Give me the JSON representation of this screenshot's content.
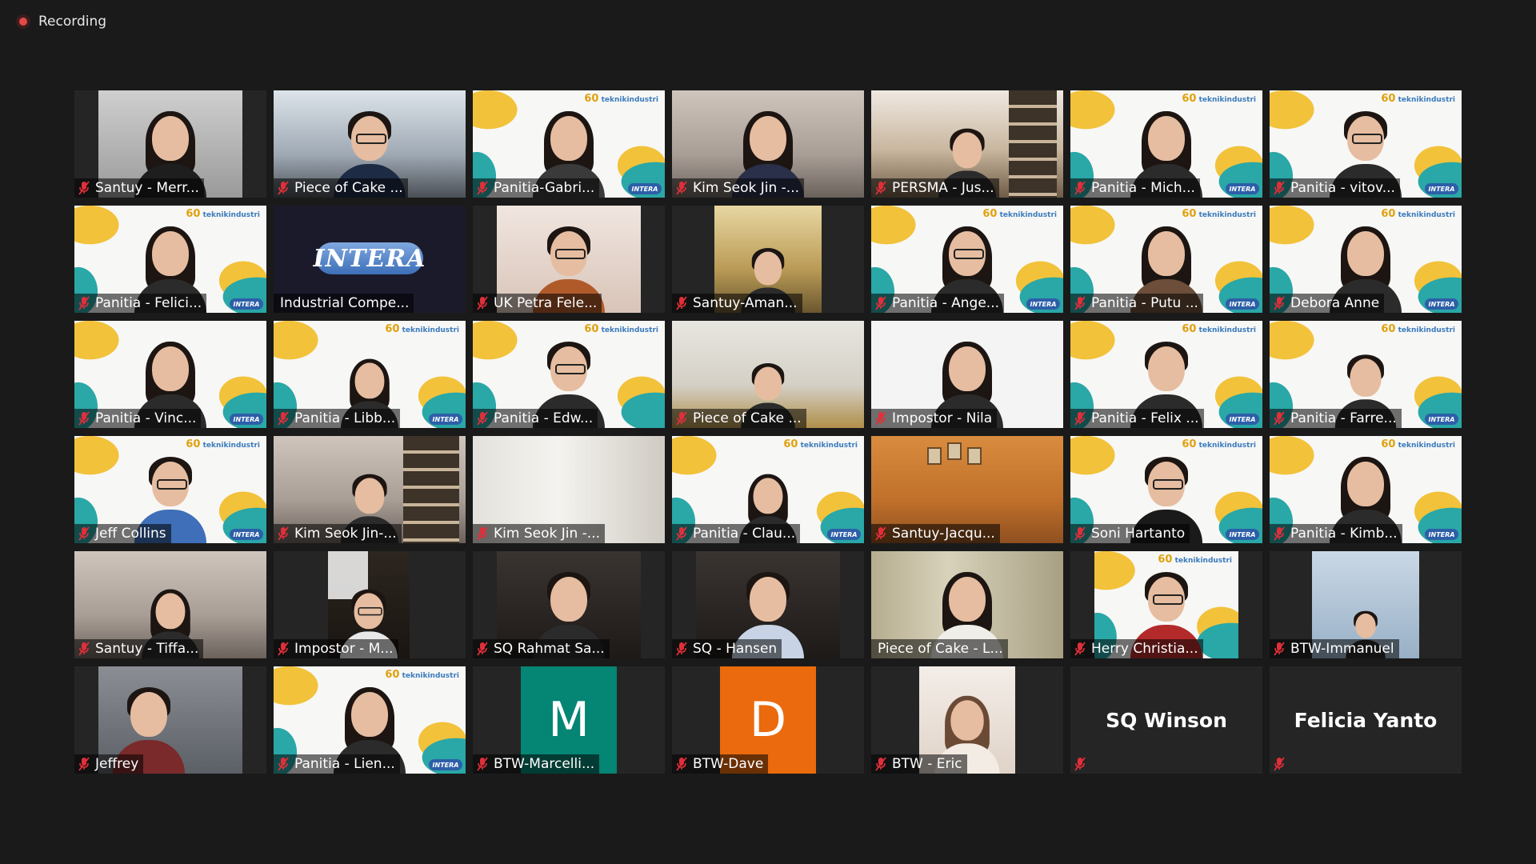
{
  "recording": {
    "label": "Recording"
  },
  "participants": [
    {
      "name": "Santuy - Merr...",
      "muted": true
    },
    {
      "name": "Piece of Cake ...",
      "muted": true
    },
    {
      "name": "Panitia-Gabri...",
      "muted": true
    },
    {
      "name": "Kim Seok Jin -...",
      "muted": true
    },
    {
      "name": "PERSMA - Jus...",
      "muted": true
    },
    {
      "name": "Panitia - Mich...",
      "muted": true
    },
    {
      "name": "Panitia - vitov...",
      "muted": true
    },
    {
      "name": "Panitia - Felici...",
      "muted": true
    },
    {
      "name": "Industrial Compe...",
      "muted": false
    },
    {
      "name": "UK Petra Fele...",
      "muted": true
    },
    {
      "name": "Santuy-Aman...",
      "muted": true
    },
    {
      "name": "Panitia - Ange...",
      "muted": true
    },
    {
      "name": "Panitia - Putu ...",
      "muted": true
    },
    {
      "name": "Debora Anne",
      "muted": true
    },
    {
      "name": "Panitia - Vinc...",
      "muted": true
    },
    {
      "name": "Panitia - Libb...",
      "muted": true
    },
    {
      "name": "Panitia - Edw...",
      "muted": true
    },
    {
      "name": "Piece of Cake ...",
      "muted": true
    },
    {
      "name": "Impostor - Nila",
      "muted": true
    },
    {
      "name": "Panitia - Felix ...",
      "muted": true
    },
    {
      "name": "Panitia - Farre...",
      "muted": true
    },
    {
      "name": "Jeff Collins",
      "muted": true
    },
    {
      "name": "Kim Seok Jin-...",
      "muted": true
    },
    {
      "name": "Kim Seok Jin -...",
      "muted": true
    },
    {
      "name": "Panitia - Clau...",
      "muted": true
    },
    {
      "name": "Santuy-Jacqu...",
      "muted": true
    },
    {
      "name": "Soni Hartanto",
      "muted": true
    },
    {
      "name": "Panitia - Kimb...",
      "muted": true
    },
    {
      "name": "Santuy - Tiffa...",
      "muted": true
    },
    {
      "name": "Impostor - M...",
      "muted": true
    },
    {
      "name": "SQ Rahmat Sa...",
      "muted": true
    },
    {
      "name": "SQ - Hansen",
      "muted": true
    },
    {
      "name": "Piece of Cake - L...",
      "muted": false
    },
    {
      "name": "Herry Christia...",
      "muted": true
    },
    {
      "name": "BTW-Immanuel",
      "muted": true
    },
    {
      "name": "Jeffrey",
      "muted": true
    },
    {
      "name": "Panitia - Lien...",
      "muted": true
    },
    {
      "name": "BTW-Marcelli...",
      "muted": true,
      "initial": "M"
    },
    {
      "name": "BTW-Dave",
      "muted": true,
      "initial": "D"
    },
    {
      "name": "BTW - Eric",
      "muted": true
    },
    {
      "display_name": "SQ Winson",
      "muted": true
    },
    {
      "display_name": "Felicia Yanto",
      "muted": true
    }
  ],
  "virtual_background": {
    "logo_text": "INTERA",
    "badge_number": "60",
    "badge_caption": "teknikindustri"
  },
  "colors": {
    "background": "#1a1a1a",
    "tile": "#252525",
    "muted_icon": "#e02f3a",
    "initial_m": "#058574",
    "initial_d": "#ea6a0d"
  }
}
